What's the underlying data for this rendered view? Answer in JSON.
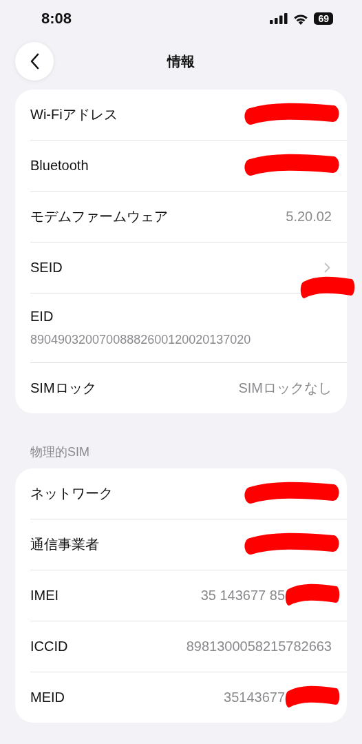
{
  "status_bar": {
    "time": "8:08",
    "battery": "69"
  },
  "nav": {
    "title": "情報"
  },
  "sections": [
    {
      "rows": [
        {
          "kind": "value",
          "label": "Wi-Fiアドレス",
          "redacted": true
        },
        {
          "kind": "value",
          "label": "Bluetooth",
          "redacted": true
        },
        {
          "kind": "value",
          "label": "モデムファームウェア",
          "value": "5.20.02",
          "redacted": false
        },
        {
          "kind": "chevron",
          "label": "SEID",
          "redacted": true
        },
        {
          "kind": "stacked",
          "label": "EID",
          "value": "89049032007008882600120020137020",
          "redacted": false
        },
        {
          "kind": "value",
          "label": "SIMロック",
          "value": "SIMロックなし",
          "redacted": false
        }
      ]
    },
    {
      "header": "物理的SIM",
      "rows": [
        {
          "kind": "value",
          "label": "ネットワーク",
          "redacted": true
        },
        {
          "kind": "value",
          "label": "通信事業者",
          "redacted": true
        },
        {
          "kind": "value",
          "label": "IMEI",
          "value": "35 143677 85",
          "redacted": true
        },
        {
          "kind": "value",
          "label": "ICCID",
          "value": "8981300058215782663",
          "redacted": false
        },
        {
          "kind": "value",
          "label": "MEID",
          "value": "35143677",
          "redacted": true
        }
      ]
    }
  ]
}
